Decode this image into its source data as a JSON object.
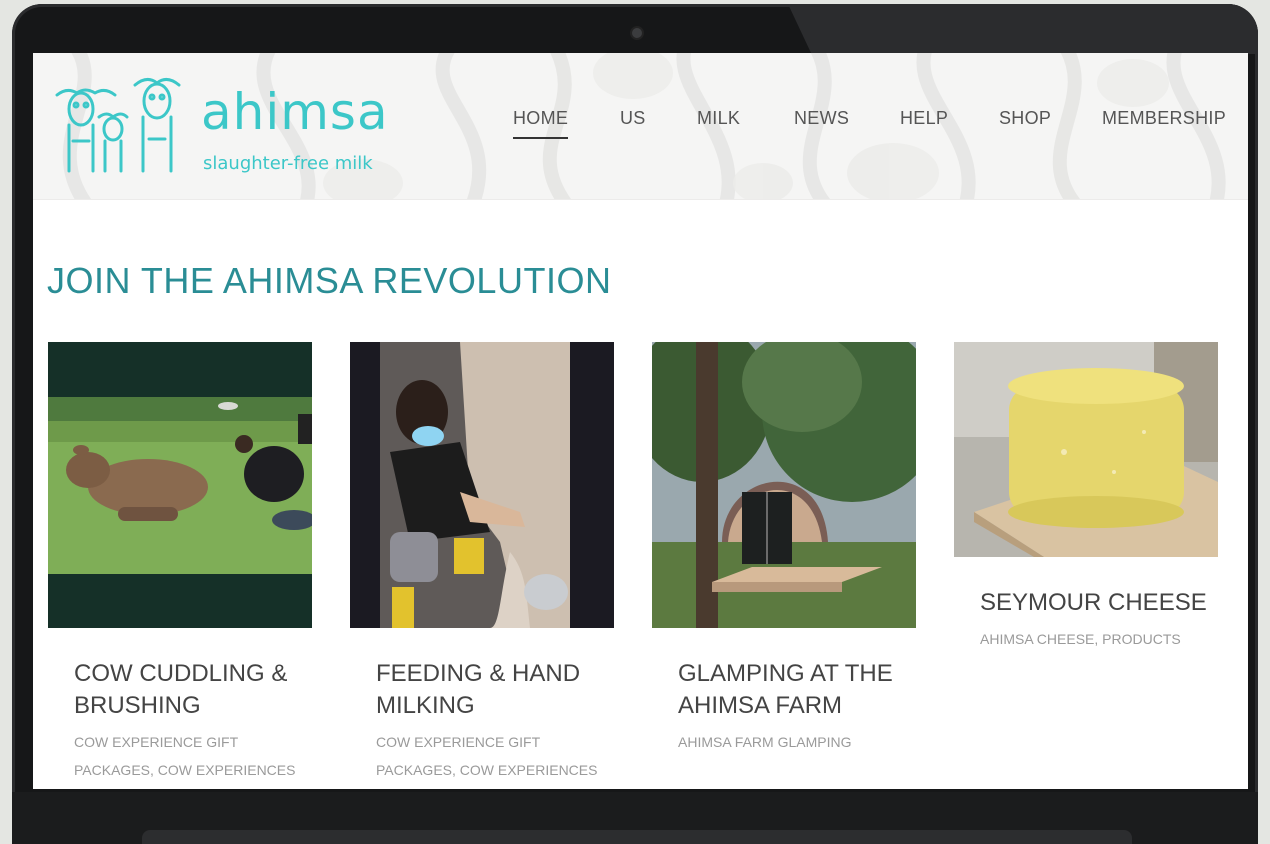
{
  "logo": {
    "name": "ahimsa",
    "tagline": "slaughter-free milk"
  },
  "nav": {
    "items": [
      {
        "label": "HOME",
        "active": true
      },
      {
        "label": "US"
      },
      {
        "label": "MILK"
      },
      {
        "label": "NEWS"
      },
      {
        "label": "HELP"
      },
      {
        "label": "SHOP"
      },
      {
        "label": "MEMBERSHIP"
      }
    ]
  },
  "main": {
    "heading": "JOIN THE AHIMSA REVOLUTION",
    "cards": [
      {
        "title_line1": "COW CUDDLING &",
        "title_line2": "BRUSHING",
        "tags_line1": "COW EXPERIENCE GIFT",
        "tags_line2a": "PACKAGES",
        "tags_line2b": ", ",
        "tags_line2c": "COW EXPERIENCES"
      },
      {
        "title_line1": "FEEDING & HAND",
        "title_line2": "MILKING",
        "tags_line1": "COW EXPERIENCE GIFT",
        "tags_line2a": "PACKAGES",
        "tags_line2b": ", ",
        "tags_line2c": "COW EXPERIENCES"
      },
      {
        "title_line1": "GLAMPING AT THE",
        "title_line2": "AHIMSA FARM",
        "tags_line1": "AHIMSA FARM GLAMPING"
      },
      {
        "title_line1": "SEYMOUR CHEESE",
        "tags_line1a": "AHIMSA CHEESE",
        "tags_line1b": ", ",
        "tags_line1c": "PRODUCTS"
      }
    ]
  },
  "colors": {
    "brand_teal": "#3cc7c8",
    "heading_teal": "#2a8d95",
    "dark_green": "#153028"
  },
  "icons": [
    "cow-family-logo-icon",
    "laptop-camera-icon"
  ]
}
